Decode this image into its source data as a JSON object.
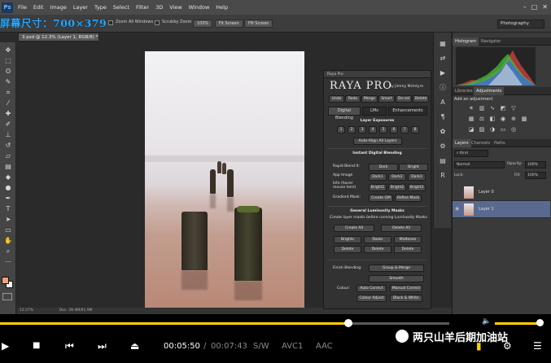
{
  "menubar": {
    "logo": "Ps",
    "items": [
      "File",
      "Edit",
      "Image",
      "Layer",
      "Type",
      "Select",
      "Filter",
      "3D",
      "View",
      "Window",
      "Help"
    ],
    "window_controls": [
      "–",
      "□",
      "✕"
    ]
  },
  "overlay_title": "屏幕尺寸：700×379",
  "options": {
    "zoom_all_windows": "Zoom All Windows",
    "scrubby_zoom": "Scrubby Zoom",
    "btn_100": "100%",
    "btn_fit": "Fit Screen",
    "btn_fill": "Fill Screen",
    "workspace": "Photography"
  },
  "document": {
    "tab_title": "3.psd @ 12.3% (Layer 1, RGB/8) *",
    "zoom": "12.27%",
    "doc_info": "Doc: 39.4M/91.9M"
  },
  "raya": {
    "panel_title": "Raya Pro",
    "logo": "RAYA PRO",
    "byline": "By Jimmy McIntyre",
    "top_buttons": [
      "Undo",
      "Redo",
      "Merge",
      "Smart",
      "De-sel",
      "Delete"
    ],
    "tabs": [
      "Digital Blending",
      "LMs",
      "Enhancements"
    ],
    "layer_exposures_title": "Layer Exposures",
    "exposure_buttons": [
      "1",
      "2",
      "3",
      "4",
      "5",
      "6",
      "7",
      "8"
    ],
    "auto_align": "Auto-Align All Layers",
    "instant_title": "Instant Digital Blending",
    "rapid_blend_label": "Rapid Blend It:",
    "rapid_dark": "Dark",
    "rapid_bright": "Bright",
    "app_image_label": "App Image",
    "dark_buttons": [
      "Dark1",
      "Dark2",
      "Dark3"
    ],
    "bright_buttons": [
      "Bright1",
      "Bright2",
      "Bright3"
    ],
    "info_label": "Info (hover mouse here)",
    "gradient_mask_label": "Gradient Mask:",
    "create_gm": "Create GM",
    "refine_mask": "Refine Mask",
    "general_lm_title": "General Luminosity Masks",
    "general_lm_sub": "Create layer masks before running Luminosity Masks",
    "create_all": "Create All",
    "delete_all": "Delete All",
    "lm_buttons": [
      "Brights",
      "Darks",
      "Midtones"
    ],
    "lm_delete": [
      "Delete",
      "Delete",
      "Delete"
    ],
    "finish_label": "Finish Blending:",
    "group_merge": "Group & Merge",
    "smooth": "Smooth",
    "colour_label": "Colour:",
    "auto_correct": "Auto Correct",
    "manual_correct": "Manual Correct",
    "colour_adjust": "Colour Adjust",
    "black_white": "Black & White"
  },
  "panels": {
    "histogram_tabs": [
      "Histogram",
      "Navigator"
    ],
    "adjust_tabs": [
      "Libraries",
      "Adjustments"
    ],
    "add_adjustment": "Add an adjustment",
    "layers_tabs": [
      "Layers",
      "Channels",
      "Paths"
    ],
    "kind_filter": "Kind",
    "blend_mode": "Normal",
    "opacity_label": "Opacity:",
    "opacity_value": "100%",
    "lock_label": "Lock:",
    "fill_label": "Fill:",
    "fill_value": "100%",
    "layers": [
      {
        "name": "Layer 0",
        "selected": false
      },
      {
        "name": "Layer 1",
        "selected": true
      }
    ]
  },
  "player": {
    "current_time": "00:05:50",
    "separator": "/",
    "total_time": "00:07:43",
    "sw": "S/W",
    "video_codec": "AVC1",
    "audio_codec": "AAC",
    "progress": 0.776,
    "volume": 0.95,
    "accent": "#ffd100"
  },
  "watermark": "两只山羊后期加油站"
}
